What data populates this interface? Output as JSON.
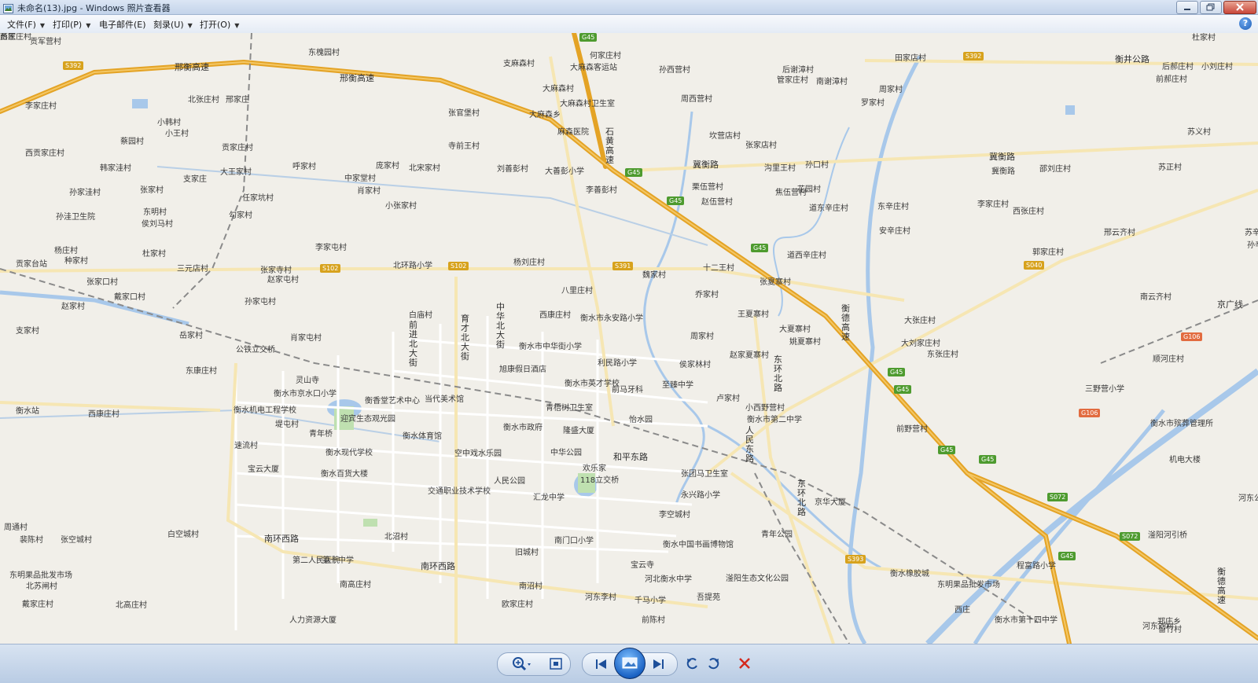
{
  "window": {
    "title": "未命名(13).jpg - Windows 照片查看器"
  },
  "menu": [
    {
      "label": "文件(F)"
    },
    {
      "label": "打印(P)"
    },
    {
      "label": "电子邮件(E)"
    },
    {
      "label": "刻录(U)"
    },
    {
      "label": "打开(O)"
    }
  ],
  "map": {
    "roads": [
      "邢衡高速",
      "邢衡高速",
      "冀衡路",
      "冀衡路",
      "衡井公路",
      "石黄高速",
      "衡德高速",
      "衡德高速",
      "京广线",
      "和平东路",
      "南环西路",
      "南环西路",
      "东环北路",
      "东环北路",
      "人民东路",
      "中华北大街",
      "育才北大街",
      "前进北大街"
    ],
    "shields": [
      "S392",
      "S392",
      "G45",
      "G45",
      "G45",
      "G45",
      "G45",
      "G45",
      "G45",
      "G45",
      "G45",
      "S102",
      "S102",
      "S391",
      "S040",
      "G106",
      "G106",
      "S072",
      "S072",
      "S393"
    ],
    "places": [
      "贡军营村",
      "东槐园村",
      "支麻森村",
      "何家庄村",
      "大麻森客运站",
      "孙西营村",
      "后谢漳村",
      "管家庄村",
      "南谢漳村",
      "田家店村",
      "杜家村",
      "后郝庄村",
      "小刘庄村",
      "前郝庄村",
      "李家庄村",
      "北张庄村",
      "邢家庄",
      "小韩村",
      "小王村",
      "蔡园村",
      "西贡家庄村",
      "贡家庄村",
      "张官堡村",
      "大麻森村",
      "大麻森村卫生室",
      "大麻森乡",
      "周西营村",
      "罗家村",
      "周家村",
      "寺前王村",
      "麻森医院",
      "坎营店村",
      "张家店村",
      "苏义村",
      "韩家洼村",
      "呼家村",
      "庞家村",
      "北宋家村",
      "刘善彭村",
      "大善彭小学",
      "冀衡路",
      "沟里王村",
      "孙口村",
      "邵刘庄村",
      "苏正村",
      "支家庄",
      "大王家村",
      "中家堂村",
      "孙家洼村",
      "张家村",
      "任家坑村",
      "肖家村",
      "李善彭村",
      "栗伍营村",
      "赵伍营村",
      "焦伍营村",
      "花园村",
      "道东辛庄村",
      "东辛庄村",
      "安辛庄村",
      "李家庄村",
      "西张庄村",
      "孙洼卫生院",
      "小张家村",
      "侯刘马村",
      "勾家村",
      "东明村",
      "邢云齐村",
      "苏辛庄",
      "孙辛村",
      "杨庄村",
      "种家村",
      "杜家村",
      "李家屯村",
      "郭家庄村",
      "贡家台站",
      "三元店村",
      "张家寺村",
      "北环路小学",
      "杨刘庄村",
      "十二王村",
      "道西辛庄村",
      "张家口村",
      "赵家屯村",
      "魏家村",
      "戴家口村",
      "孙家屯村",
      "八里庄村",
      "乔家村",
      "张夏寨村",
      "南云齐村",
      "赵家村",
      "白庙村",
      "西康庄村",
      "衡水市永安路小学",
      "王夏寨村",
      "大夏寨村",
      "大张庄村",
      "支家村",
      "岳家村",
      "肖家屯村",
      "周家村",
      "姚夏寨村",
      "大刘家庄村",
      "东张庄村",
      "顺河庄村",
      "公铁立交桥",
      "衡水市中华街小学",
      "赵家夏寨村",
      "旭康假日酒店",
      "利民路小学",
      "侯家林村",
      "东康庄村",
      "灵山寺",
      "衡水市英才学校",
      "前马牙科",
      "至臻中学",
      "卢家村",
      "小西野营村",
      "三野营小学",
      "衡水市京水口小学",
      "衡香堂艺术中心",
      "当代美术馆",
      "青梧树卫生室",
      "衡水站",
      "西康庄村",
      "衡水机电工程学校",
      "迎宾生态观光园",
      "怡水园",
      "衡水市第二中学",
      "前野营村",
      "衡水市殡葬管理所",
      "堤屯村",
      "青年桥",
      "衡水体育馆",
      "衡水市政府",
      "隆盛大厦",
      "机电大楼",
      "速流村",
      "衡水现代学校",
      "空中戏水乐园",
      "中华公园",
      "欢乐家",
      "张团马卫生室",
      "宝云大厦",
      "衡水百货大楼",
      "人民公园",
      "118立交桥",
      "交通职业技术学校",
      "汇龙中学",
      "永兴路小学",
      "京华大厦",
      "河东公园",
      "周通村",
      "裴陈村",
      "张空城村",
      "白空城村",
      "李空城村",
      "北沼村",
      "南门口小学",
      "衡水中国书画博物馆",
      "青年公园",
      "第二人民医院",
      "第十中学",
      "旧城村",
      "宝云寺",
      "滏阳生态文化公园",
      "河北衡水中学",
      "程富路小学",
      "东明果品批发市场",
      "北苏闸村",
      "戴家庄村",
      "北高庄村",
      "南高庄村",
      "南沼村",
      "河东李村",
      "千马小学",
      "吾提苑",
      "衡水橡胶城",
      "东明果品批发市场",
      "滏阳河引桥",
      "欧家庄村",
      "前陈村",
      "人力资源大厦",
      "衡水市第十四中学",
      "河东刘村",
      "郑庄乡",
      "西庄",
      "留竹村",
      "彭家庄村",
      "西庄"
    ]
  },
  "toolbar": {
    "buttons": [
      "zoom",
      "actual-size",
      "previous",
      "slideshow",
      "next",
      "rotate-ccw",
      "rotate-cw",
      "delete"
    ]
  }
}
